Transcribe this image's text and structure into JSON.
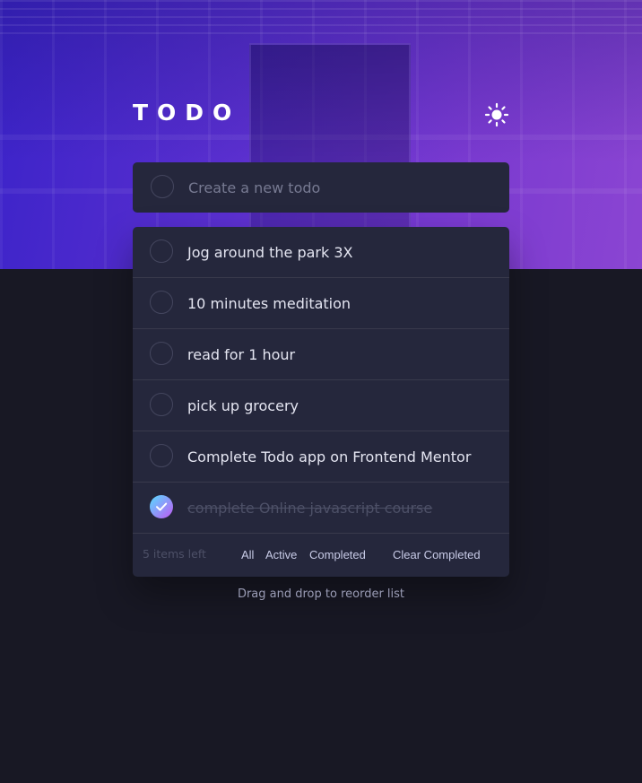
{
  "app": {
    "title": "TODO",
    "theme_toggle_icon": "sun-icon"
  },
  "new_todo": {
    "placeholder": "Create a new todo",
    "value": ""
  },
  "todos": [
    {
      "label": "Jog around the park 3X",
      "completed": false
    },
    {
      "label": "10 minutes meditation",
      "completed": false
    },
    {
      "label": "read for 1 hour",
      "completed": false
    },
    {
      "label": "pick up grocery",
      "completed": false
    },
    {
      "label": "Complete Todo app on Frontend Mentor",
      "completed": false
    },
    {
      "label": "complete Online javascript course",
      "completed": true
    }
  ],
  "footer": {
    "items_left": "5 items left",
    "filters": [
      "All",
      "Active",
      "Completed"
    ],
    "clear_label": "Clear Completed"
  },
  "hint": "Drag and drop to reorder list",
  "colors": {
    "background": "#181824",
    "card": "#25273c",
    "check_gradient_start": "#57ddff",
    "check_gradient_end": "#c058f3",
    "hero_start": "#3b23c9",
    "hero_end": "#8b45d2"
  }
}
